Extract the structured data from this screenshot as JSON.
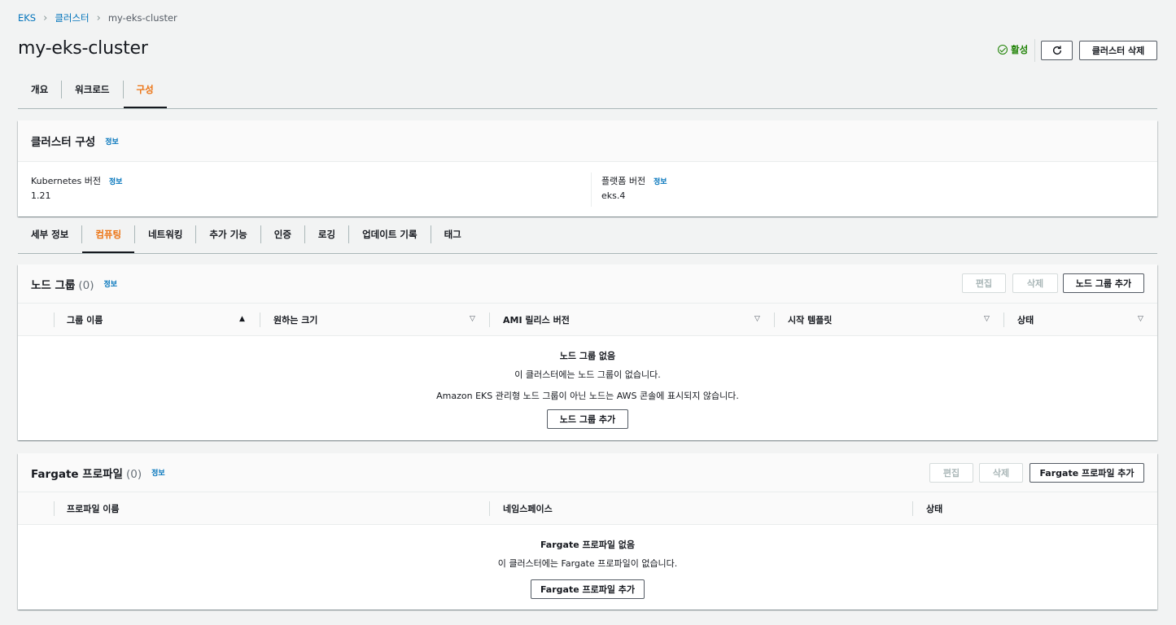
{
  "breadcrumb": {
    "items": [
      "EKS",
      "클러스터"
    ],
    "current": "my-eks-cluster"
  },
  "page": {
    "title": "my-eks-cluster",
    "status": "활성",
    "delete_label": "클러스터 삭제"
  },
  "main_tabs": [
    "개요",
    "워크로드",
    "구성"
  ],
  "cluster_config": {
    "title": "클러스터 구성",
    "info": "정보",
    "k8s_label": "Kubernetes 버전",
    "k8s_value": "1.21",
    "platform_label": "플랫폼 버전",
    "platform_value": "eks.4"
  },
  "sub_tabs": [
    "세부 정보",
    "컴퓨팅",
    "네트워킹",
    "추가 기능",
    "인증",
    "로깅",
    "업데이트 기록",
    "태그"
  ],
  "node_groups": {
    "title": "노드 그룹",
    "count": "(0)",
    "info": "정보",
    "edit": "편집",
    "delete": "삭제",
    "add": "노드 그룹 추가",
    "columns": [
      "그룹 이름",
      "원하는 크기",
      "AMI 릴리스 버전",
      "시작 템플릿",
      "상태"
    ],
    "empty_title": "노드 그룹 없음",
    "empty_line1": "이 클러스터에는 노드 그룹이 없습니다.",
    "empty_line2": "Amazon EKS 관리형 노드 그룹이 아닌 노드는 AWS 콘솔에 표시되지 않습니다.",
    "empty_button": "노드 그룹 추가"
  },
  "fargate": {
    "title": "Fargate 프로파일",
    "count": "(0)",
    "info": "정보",
    "edit": "편집",
    "delete": "삭제",
    "add": "Fargate 프로파일 추가",
    "columns": [
      "프로파일 이름",
      "네임스페이스",
      "상태"
    ],
    "empty_title": "Fargate 프로파일 없음",
    "empty_line1": "이 클러스터에는 Fargate 프로파일이 없습니다.",
    "empty_button": "Fargate 프로파일 추가"
  },
  "colors": {
    "link": "#0073bb",
    "active_tab": "#ec7211",
    "status_ok": "#1d8102"
  }
}
